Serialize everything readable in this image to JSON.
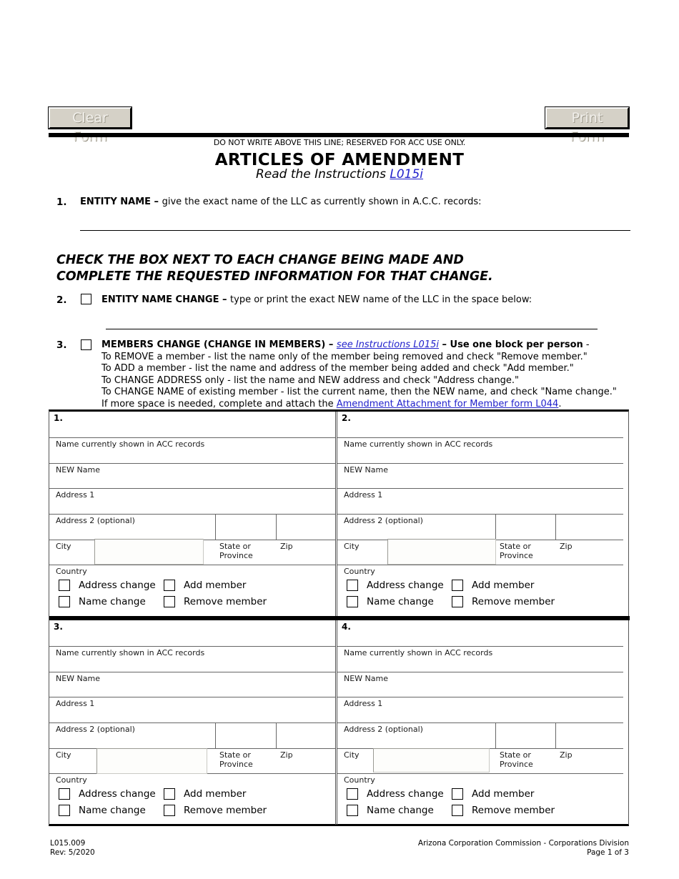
{
  "toolbar": {
    "clear_form_label": "Clear Form",
    "print_form_label": "Print Form"
  },
  "header": {
    "acc_notice": "DO NOT WRITE ABOVE THIS LINE; RESERVED FOR ACC USE ONLY.",
    "title": "ARTICLES OF AMENDMENT",
    "subtitle_prefix": "Read the Instructions ",
    "subtitle_link": "L015i"
  },
  "items": {
    "item1": {
      "number": "1.",
      "label_bold": "ENTITY NAME – ",
      "label_rest": "give the exact name of the LLC as currently shown in A.C.C. records:"
    },
    "instruction_block": {
      "line1": "CHECK THE BOX NEXT TO EACH CHANGE BEING MADE AND",
      "line2": "COMPLETE THE REQUESTED INFORMATION FOR THAT CHANGE."
    },
    "item2": {
      "number": "2.",
      "label_bold": "ENTITY NAME CHANGE – ",
      "label_rest": "type or print the exact NEW name of the LLC in the space below:"
    },
    "item3": {
      "number": "3.",
      "head_bold_1": "MEMBERS CHANGE (CHANGE IN MEMBERS) – ",
      "head_link": "see Instructions L015i",
      "head_bold_2": " – Use one block per person",
      "head_tail": " -",
      "line_remove": "To REMOVE a member - list the name only of the member being removed and check \"Remove member.\"",
      "line_add": "To ADD  a member - list the name and address of the member being added and check \"Add member.\"",
      "line_address": "To CHANGE ADDRESS only - list the name and NEW address and check \"Address change.\"",
      "line_name": "To CHANGE NAME of existing member - list the current name, then the NEW name, and check \"Name change.\"",
      "line_more_prefix": "If more space is needed, complete and attach the ",
      "line_more_link": "Amendment Attachment for Member form L044",
      "line_more_suffix": "."
    }
  },
  "member_table": {
    "row_labels": {
      "name_current": "Name currently shown in ACC records",
      "new_name": "NEW Name",
      "address1": "Address 1",
      "address2": "Address 2 (optional)",
      "city": "City",
      "state": "State or Province",
      "state_l1": "State or",
      "state_l2": "Province",
      "zip": "Zip",
      "country": "Country"
    },
    "checkbox_labels": {
      "address_change": "Address change",
      "add_member": "Add member",
      "name_change": "Name change",
      "remove_member": "Remove member"
    },
    "blocks": [
      {
        "number": "1."
      },
      {
        "number": "2."
      },
      {
        "number": "3."
      },
      {
        "number": "4."
      }
    ]
  },
  "footer": {
    "form_code": "L015.009",
    "revision": "Rev: 5/2020",
    "agency": "Arizona Corporation Commission  - Corporations Division",
    "page": "Page 1 of 3"
  },
  "colors": {
    "link": "#2222cc",
    "button_face": "#d5d1c7",
    "rule": "#000000"
  }
}
